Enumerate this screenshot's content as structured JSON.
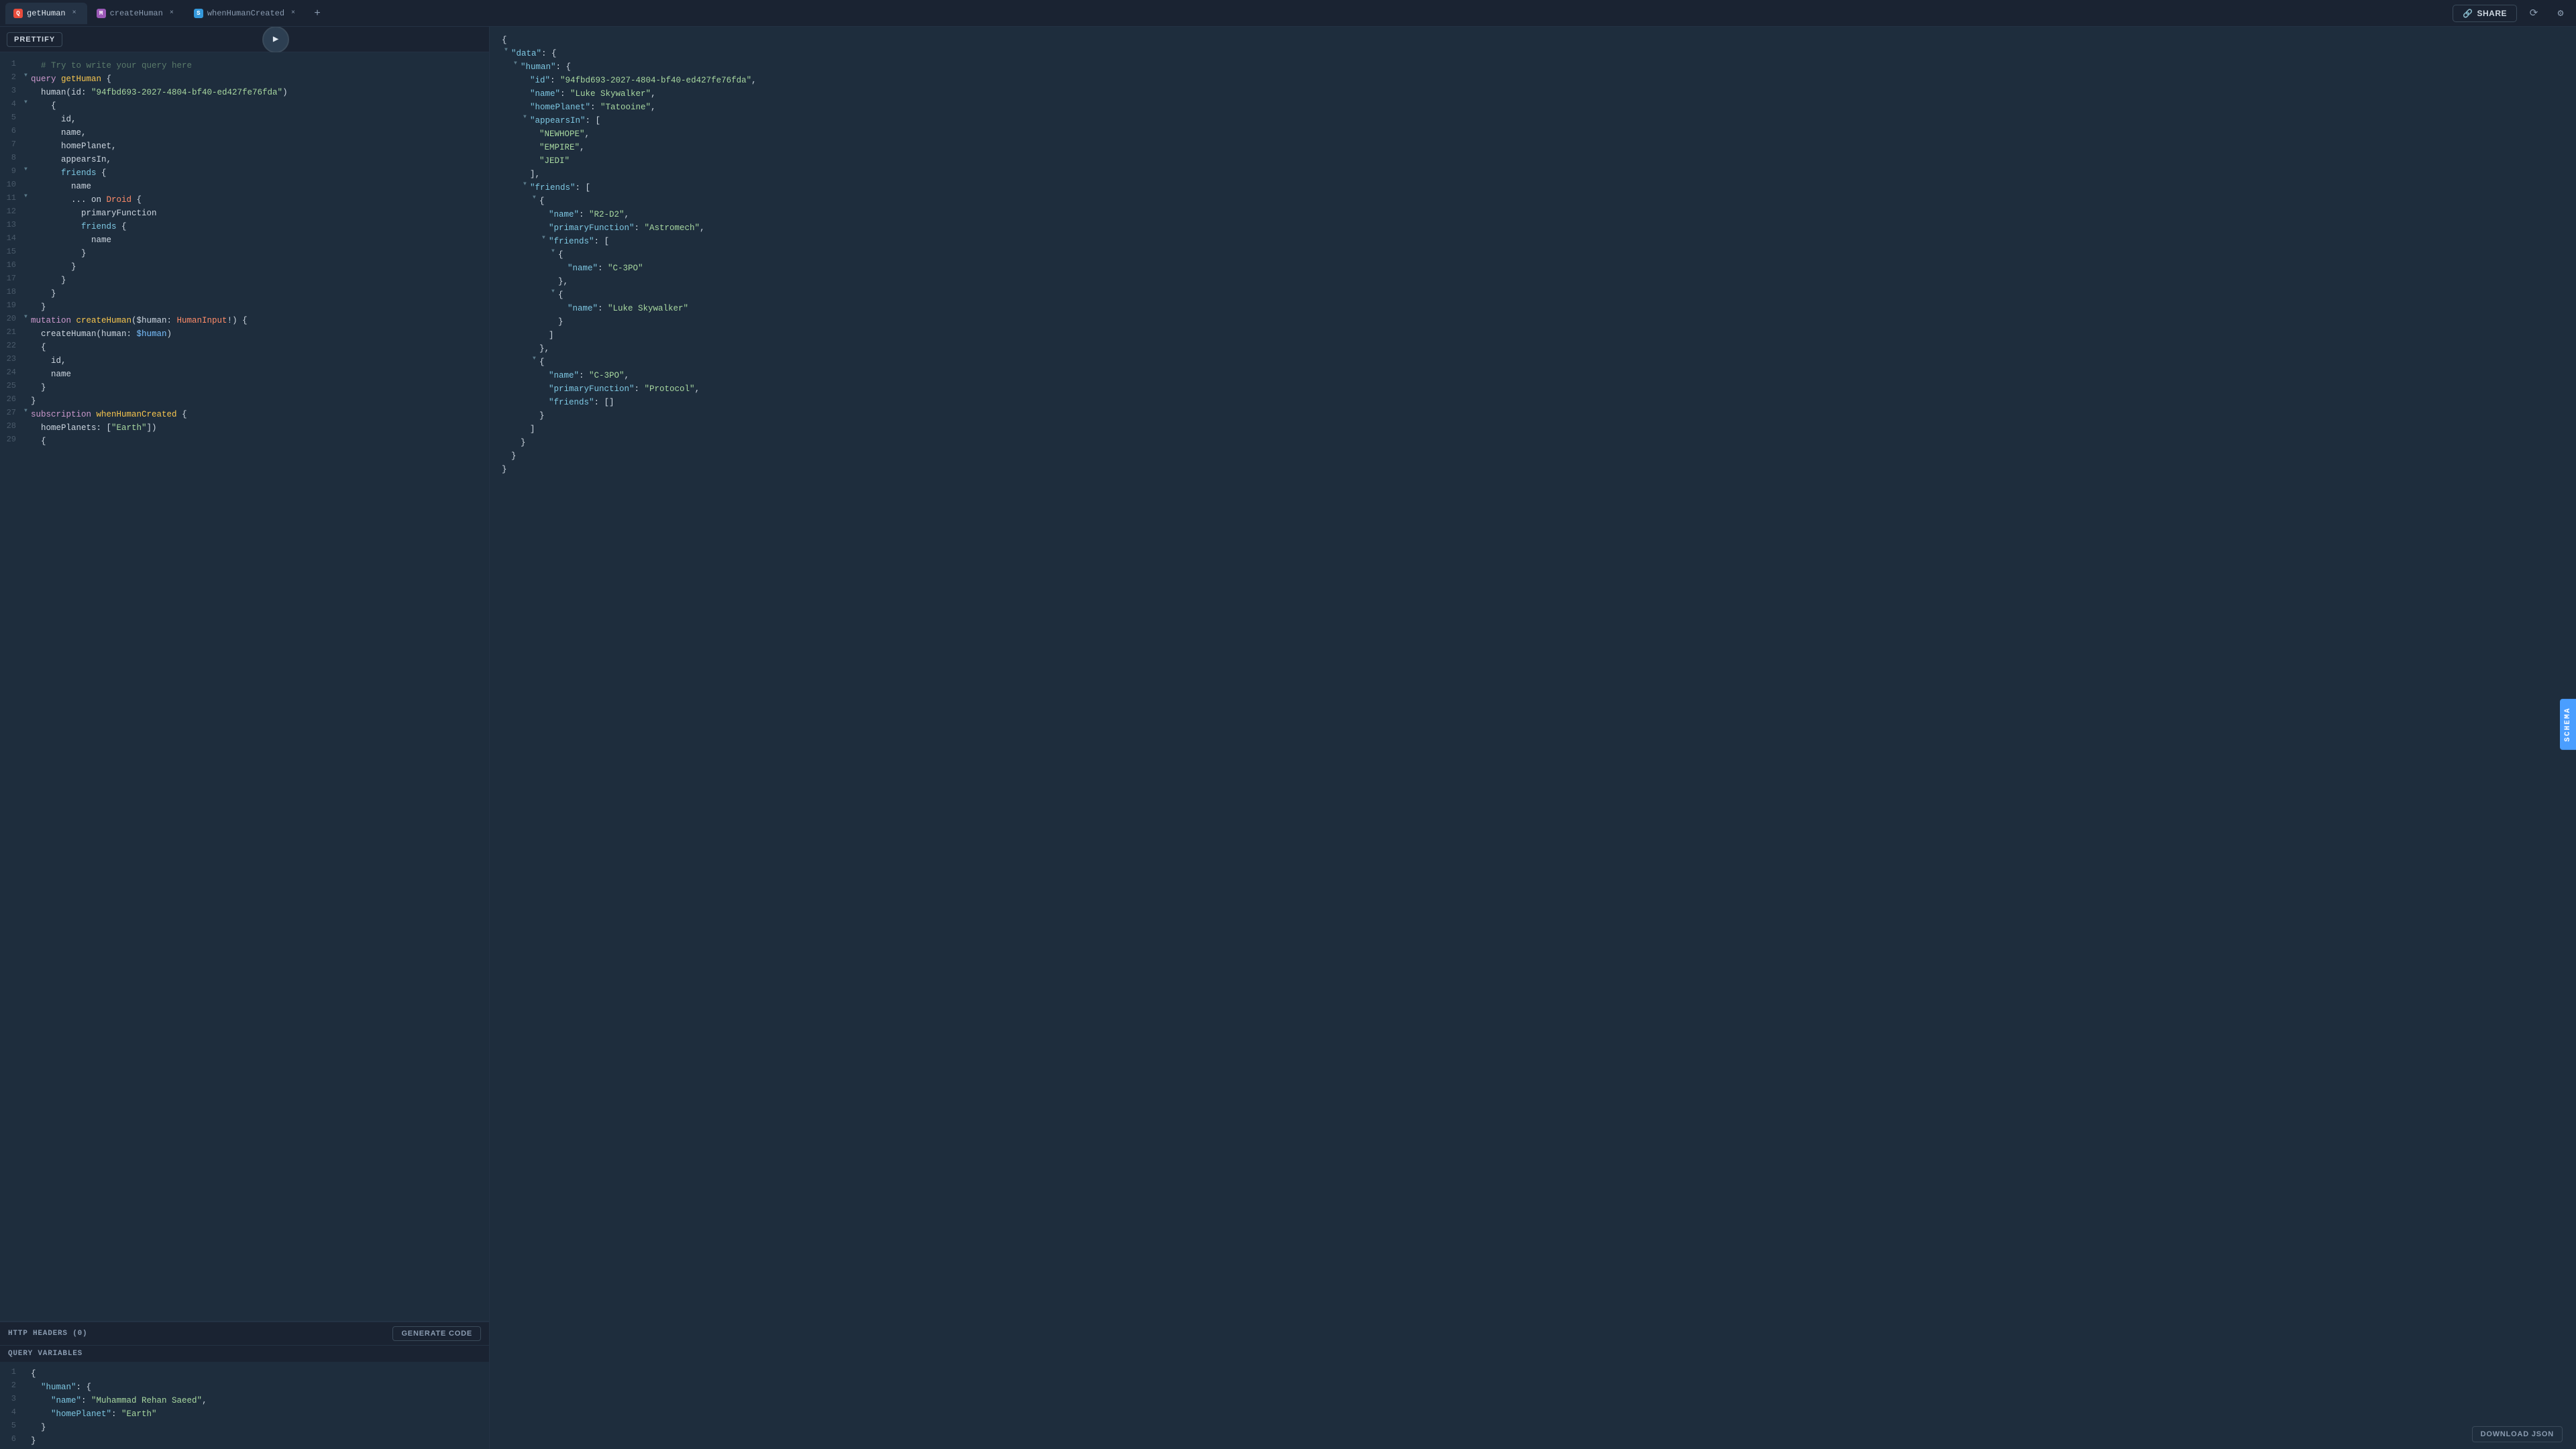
{
  "tabs": [
    {
      "id": "getHuman",
      "label": "getHuman",
      "icon_color": "#e74c3c",
      "icon_letter": "Q",
      "active": true
    },
    {
      "id": "createHuman",
      "label": "createHuman",
      "icon_color": "#9b59b6",
      "icon_letter": "M",
      "active": false
    },
    {
      "id": "whenHumanCreated",
      "label": "whenHumanCreated",
      "icon_color": "#3498db",
      "icon_letter": "S",
      "active": false
    }
  ],
  "toolbar": {
    "prettify_label": "PRETTIFY",
    "share_label": "SHARE"
  },
  "schema_tab_label": "SCHEMA",
  "editor_lines": [
    {
      "num": 1,
      "indicator": "",
      "content": "  # Try to write your query here",
      "class": "c-comment"
    },
    {
      "num": 2,
      "indicator": "▼",
      "content_parts": [
        {
          "text": "query ",
          "class": "c-kw"
        },
        {
          "text": "getHuman",
          "class": "c-name"
        },
        {
          "text": " {",
          "class": "c-brace"
        }
      ]
    },
    {
      "num": 3,
      "indicator": "",
      "content_parts": [
        {
          "text": "  human(id: ",
          "class": "c-brace"
        },
        {
          "text": "\"94fbd693-2027-4804-bf40-ed427fe76fda\"",
          "class": "c-str"
        },
        {
          "text": ")",
          "class": "c-brace"
        }
      ]
    },
    {
      "num": 4,
      "indicator": "▼",
      "content": "    {",
      "class": "c-brace"
    },
    {
      "num": 5,
      "indicator": "",
      "content": "      id,",
      "class": "c-brace"
    },
    {
      "num": 6,
      "indicator": "",
      "content": "      name,",
      "class": "c-brace"
    },
    {
      "num": 7,
      "indicator": "",
      "content": "      homePlanet,",
      "class": "c-brace"
    },
    {
      "num": 8,
      "indicator": "",
      "content": "      appearsIn,",
      "class": "c-brace"
    },
    {
      "num": 9,
      "indicator": "▼",
      "content_parts": [
        {
          "text": "      friends",
          "class": "c-key"
        },
        {
          "text": " {",
          "class": "c-brace"
        }
      ]
    },
    {
      "num": 10,
      "indicator": "",
      "content": "        name",
      "class": "c-brace"
    },
    {
      "num": 11,
      "indicator": "▼",
      "content_parts": [
        {
          "text": "        ... on ",
          "class": "c-brace"
        },
        {
          "text": "Droid",
          "class": "c-type"
        },
        {
          "text": " {",
          "class": "c-brace"
        }
      ]
    },
    {
      "num": 12,
      "indicator": "",
      "content": "          primaryFunction",
      "class": "c-brace"
    },
    {
      "num": 13,
      "indicator": "",
      "content_parts": [
        {
          "text": "          friends",
          "class": "c-key"
        },
        {
          "text": " {",
          "class": "c-brace"
        }
      ]
    },
    {
      "num": 14,
      "indicator": "",
      "content": "            name",
      "class": "c-brace"
    },
    {
      "num": 15,
      "indicator": "",
      "content": "          }",
      "class": "c-brace"
    },
    {
      "num": 16,
      "indicator": "",
      "content": "        }",
      "class": "c-brace"
    },
    {
      "num": 17,
      "indicator": "",
      "content": "      }",
      "class": "c-brace"
    },
    {
      "num": 18,
      "indicator": "",
      "content": "    }",
      "class": "c-brace"
    },
    {
      "num": 19,
      "indicator": "",
      "content": "  }",
      "class": "c-brace"
    },
    {
      "num": 20,
      "indicator": "▼",
      "content_parts": [
        {
          "text": "mutation ",
          "class": "c-kw"
        },
        {
          "text": "createHuman",
          "class": "c-name"
        },
        {
          "text": "($human: ",
          "class": "c-brace"
        },
        {
          "text": "HumanInput",
          "class": "c-type"
        },
        {
          "text": "!) {",
          "class": "c-brace"
        }
      ]
    },
    {
      "num": 21,
      "indicator": "",
      "content_parts": [
        {
          "text": "  createHuman(human: ",
          "class": "c-brace"
        },
        {
          "text": "$human",
          "class": "c-var"
        },
        {
          "text": ")",
          "class": "c-brace"
        }
      ]
    },
    {
      "num": 22,
      "indicator": "",
      "content": "  {",
      "class": "c-brace"
    },
    {
      "num": 23,
      "indicator": "",
      "content": "    id,",
      "class": "c-brace"
    },
    {
      "num": 24,
      "indicator": "",
      "content": "    name",
      "class": "c-brace"
    },
    {
      "num": 25,
      "indicator": "",
      "content": "  }",
      "class": "c-brace"
    },
    {
      "num": 26,
      "indicator": "",
      "content": "}",
      "class": "c-brace"
    },
    {
      "num": 27,
      "indicator": "▼",
      "content_parts": [
        {
          "text": "subscription ",
          "class": "c-kw"
        },
        {
          "text": "whenHumanCreated",
          "class": "c-name"
        },
        {
          "text": " {",
          "class": "c-brace"
        }
      ]
    },
    {
      "num": 28,
      "indicator": "",
      "content_parts": [
        {
          "text": "  homePlanets: [",
          "class": "c-brace"
        },
        {
          "text": "\"Earth\"",
          "class": "c-str"
        },
        {
          "text": "])",
          "class": "c-brace"
        }
      ]
    },
    {
      "num": 29,
      "indicator": "",
      "content": "  {",
      "class": "c-brace"
    }
  ],
  "http_headers_label": "HTTP HEADERS (0)",
  "generate_code_label": "GENERATE CODE",
  "query_variables_label": "QUERY VARIABLES",
  "query_var_lines": [
    {
      "num": 1,
      "content": "{",
      "class": "c-brace"
    },
    {
      "num": 2,
      "content_parts": [
        {
          "text": "  \"human\"",
          "class": "c-key"
        },
        {
          "text": ": {",
          "class": "c-brace"
        }
      ]
    },
    {
      "num": 3,
      "content_parts": [
        {
          "text": "    \"name\"",
          "class": "c-key"
        },
        {
          "text": ": ",
          "class": "c-brace"
        },
        {
          "text": "\"Muhammad Rehan Saeed\"",
          "class": "c-str"
        },
        {
          "text": ",",
          "class": "c-brace"
        }
      ]
    },
    {
      "num": 4,
      "content_parts": [
        {
          "text": "    \"homePlanet\"",
          "class": "c-key"
        },
        {
          "text": ": ",
          "class": "c-brace"
        },
        {
          "text": "\"Earth\"",
          "class": "c-str"
        }
      ]
    },
    {
      "num": 5,
      "content": "  }",
      "class": "c-brace"
    },
    {
      "num": 6,
      "content": "}",
      "class": "c-brace"
    }
  ],
  "response_lines": [
    {
      "indent": 0,
      "triangle": "",
      "content_parts": [
        {
          "text": "{",
          "class": "c-brace"
        }
      ]
    },
    {
      "indent": 1,
      "triangle": "▼",
      "content_parts": [
        {
          "text": "\"data\"",
          "class": "c-key"
        },
        {
          "text": ": {",
          "class": "c-brace"
        }
      ]
    },
    {
      "indent": 2,
      "triangle": "▼",
      "content_parts": [
        {
          "text": "\"human\"",
          "class": "c-key"
        },
        {
          "text": ": {",
          "class": "c-brace"
        }
      ]
    },
    {
      "indent": 3,
      "triangle": "",
      "content_parts": [
        {
          "text": "\"id\"",
          "class": "c-key"
        },
        {
          "text": ": ",
          "class": "c-brace"
        },
        {
          "text": "\"94fbd693-2027-4804-bf40-ed427fe76fda\"",
          "class": "c-str"
        },
        {
          "text": ",",
          "class": "c-brace"
        }
      ]
    },
    {
      "indent": 3,
      "triangle": "",
      "content_parts": [
        {
          "text": "\"name\"",
          "class": "c-key"
        },
        {
          "text": ": ",
          "class": "c-brace"
        },
        {
          "text": "\"Luke Skywalker\"",
          "class": "c-str"
        },
        {
          "text": ",",
          "class": "c-brace"
        }
      ]
    },
    {
      "indent": 3,
      "triangle": "",
      "content_parts": [
        {
          "text": "\"homePlanet\"",
          "class": "c-key"
        },
        {
          "text": ": ",
          "class": "c-brace"
        },
        {
          "text": "\"Tatooine\"",
          "class": "c-str"
        },
        {
          "text": ",",
          "class": "c-brace"
        }
      ]
    },
    {
      "indent": 3,
      "triangle": "▼",
      "content_parts": [
        {
          "text": "\"appearsIn\"",
          "class": "c-key"
        },
        {
          "text": ": [",
          "class": "c-brace"
        }
      ]
    },
    {
      "indent": 4,
      "triangle": "",
      "content_parts": [
        {
          "text": "\"NEWHOPE\"",
          "class": "c-str"
        },
        {
          "text": ",",
          "class": "c-brace"
        }
      ]
    },
    {
      "indent": 4,
      "triangle": "",
      "content_parts": [
        {
          "text": "\"EMPIRE\"",
          "class": "c-str"
        },
        {
          "text": ",",
          "class": "c-brace"
        }
      ]
    },
    {
      "indent": 4,
      "triangle": "",
      "content_parts": [
        {
          "text": "\"JEDI\"",
          "class": "c-str"
        }
      ]
    },
    {
      "indent": 3,
      "triangle": "",
      "content_parts": [
        {
          "text": "],",
          "class": "c-brace"
        }
      ]
    },
    {
      "indent": 3,
      "triangle": "▼",
      "content_parts": [
        {
          "text": "\"friends\"",
          "class": "c-key"
        },
        {
          "text": ": [",
          "class": "c-brace"
        }
      ]
    },
    {
      "indent": 4,
      "triangle": "▼",
      "content_parts": [
        {
          "text": "{",
          "class": "c-brace"
        }
      ]
    },
    {
      "indent": 5,
      "triangle": "",
      "content_parts": [
        {
          "text": "\"name\"",
          "class": "c-key"
        },
        {
          "text": ": ",
          "class": "c-brace"
        },
        {
          "text": "\"R2-D2\"",
          "class": "c-str"
        },
        {
          "text": ",",
          "class": "c-brace"
        }
      ]
    },
    {
      "indent": 5,
      "triangle": "",
      "content_parts": [
        {
          "text": "\"primaryFunction\"",
          "class": "c-key"
        },
        {
          "text": ": ",
          "class": "c-brace"
        },
        {
          "text": "\"Astromech\"",
          "class": "c-str"
        },
        {
          "text": ",",
          "class": "c-brace"
        }
      ]
    },
    {
      "indent": 5,
      "triangle": "▼",
      "content_parts": [
        {
          "text": "\"friends\"",
          "class": "c-key"
        },
        {
          "text": ": [",
          "class": "c-brace"
        }
      ]
    },
    {
      "indent": 6,
      "triangle": "▼",
      "content_parts": [
        {
          "text": "{",
          "class": "c-brace"
        }
      ]
    },
    {
      "indent": 7,
      "triangle": "",
      "content_parts": [
        {
          "text": "\"name\"",
          "class": "c-key"
        },
        {
          "text": ": ",
          "class": "c-brace"
        },
        {
          "text": "\"C-3PO\"",
          "class": "c-str"
        }
      ]
    },
    {
      "indent": 6,
      "triangle": "",
      "content_parts": [
        {
          "text": "},",
          "class": "c-brace"
        }
      ]
    },
    {
      "indent": 6,
      "triangle": "▼",
      "content_parts": [
        {
          "text": "{",
          "class": "c-brace"
        }
      ]
    },
    {
      "indent": 7,
      "triangle": "",
      "content_parts": [
        {
          "text": "\"name\"",
          "class": "c-key"
        },
        {
          "text": ": ",
          "class": "c-brace"
        },
        {
          "text": "\"Luke Skywalker\"",
          "class": "c-str"
        }
      ]
    },
    {
      "indent": 6,
      "triangle": "",
      "content_parts": [
        {
          "text": "}",
          "class": "c-brace"
        }
      ]
    },
    {
      "indent": 5,
      "triangle": "",
      "content_parts": [
        {
          "text": "]",
          "class": "c-brace"
        }
      ]
    },
    {
      "indent": 4,
      "triangle": "",
      "content_parts": [
        {
          "text": "},",
          "class": "c-brace"
        }
      ]
    },
    {
      "indent": 4,
      "triangle": "▼",
      "content_parts": [
        {
          "text": "{",
          "class": "c-brace"
        }
      ]
    },
    {
      "indent": 5,
      "triangle": "",
      "content_parts": [
        {
          "text": "\"name\"",
          "class": "c-key"
        },
        {
          "text": ": ",
          "class": "c-brace"
        },
        {
          "text": "\"C-3PO\"",
          "class": "c-str"
        },
        {
          "text": ",",
          "class": "c-brace"
        }
      ]
    },
    {
      "indent": 5,
      "triangle": "",
      "content_parts": [
        {
          "text": "\"primaryFunction\"",
          "class": "c-key"
        },
        {
          "text": ": ",
          "class": "c-brace"
        },
        {
          "text": "\"Protocol\"",
          "class": "c-str"
        },
        {
          "text": ",",
          "class": "c-brace"
        }
      ]
    },
    {
      "indent": 5,
      "triangle": "",
      "content_parts": [
        {
          "text": "\"friends\"",
          "class": "c-key"
        },
        {
          "text": ": []",
          "class": "c-brace"
        }
      ]
    },
    {
      "indent": 4,
      "triangle": "",
      "content_parts": [
        {
          "text": "}",
          "class": "c-brace"
        }
      ]
    },
    {
      "indent": 3,
      "triangle": "",
      "content_parts": [
        {
          "text": "]",
          "class": "c-brace"
        }
      ]
    },
    {
      "indent": 2,
      "triangle": "",
      "content_parts": [
        {
          "text": "}",
          "class": "c-brace"
        }
      ]
    },
    {
      "indent": 1,
      "triangle": "",
      "content_parts": [
        {
          "text": "}",
          "class": "c-brace"
        }
      ]
    },
    {
      "indent": 0,
      "triangle": "",
      "content_parts": [
        {
          "text": "}",
          "class": "c-brace"
        }
      ]
    }
  ],
  "download_json_label": "DOWNLOAD JSON"
}
